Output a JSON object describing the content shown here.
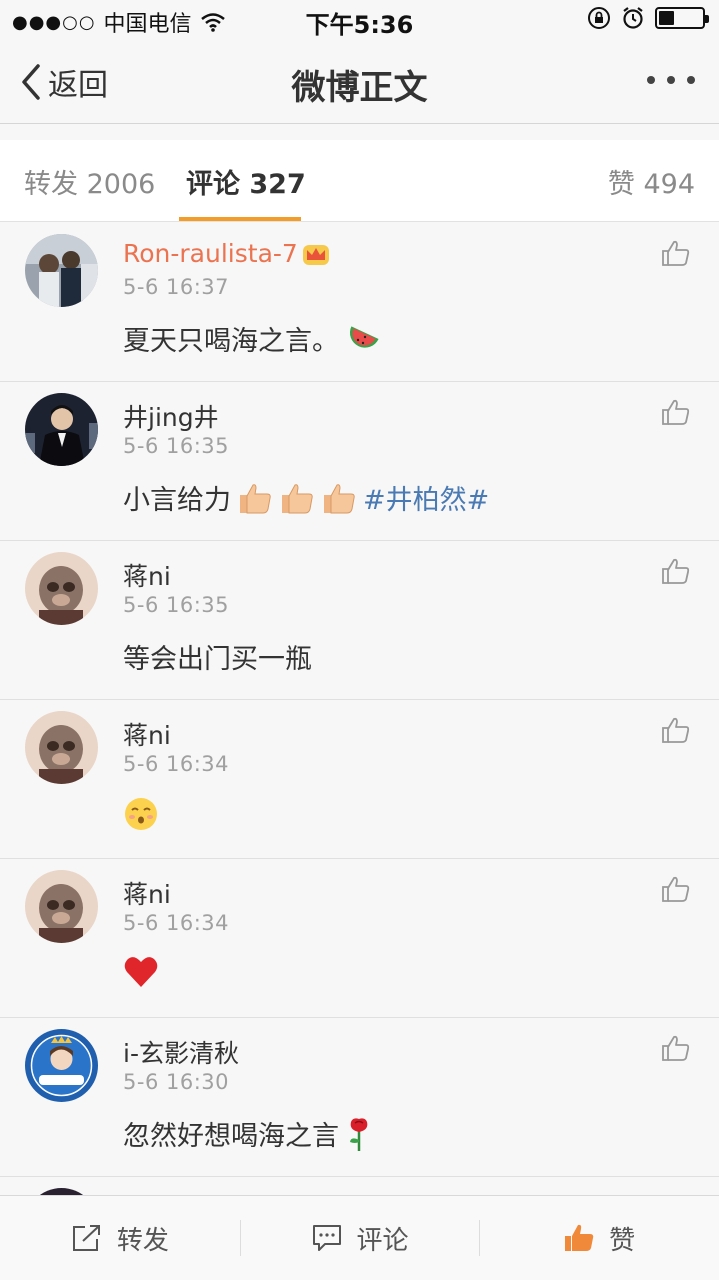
{
  "status_bar": {
    "carrier": "中国电信",
    "time": "下午5:36",
    "battery_level": 0.35
  },
  "nav": {
    "back_label": "返回",
    "title": "微博正文"
  },
  "tabs": {
    "repost": "转发 2006",
    "comment": "评论 327",
    "like": "赞 494"
  },
  "comments": [
    {
      "username": "Ron-raulista-7",
      "vip": true,
      "time": "5-6 16:37",
      "text": "夏天只喝海之言。",
      "emoji": "watermelon-emoji"
    },
    {
      "username": "井jing井",
      "vip": false,
      "time": "5-6 16:35",
      "text": "小言给力",
      "emoji": "thumbs-up-emoji",
      "emoji_count": 3,
      "topic": "#井柏然#"
    },
    {
      "username": "蒋ni",
      "vip": false,
      "time": "5-6 16:35",
      "text": "等会出门买一瓶"
    },
    {
      "username": "蒋ni",
      "vip": false,
      "time": "5-6 16:34",
      "text": "",
      "emoji": "kissing-face-emoji"
    },
    {
      "username": "蒋ni",
      "vip": false,
      "time": "5-6 16:34",
      "text": "",
      "emoji": "red-heart-emoji"
    },
    {
      "username": "i-玄影清秋",
      "vip": false,
      "time": "5-6 16:30",
      "text": "忽然好想喝海之言",
      "emoji": "rose-emoji"
    }
  ],
  "toolbar": {
    "repost": "转发",
    "comment": "评论",
    "like": "赞"
  },
  "colors": {
    "accent_orange": "#f29d2a",
    "vip_name": "#eb7350",
    "topic_blue": "#4a7ab3",
    "like_active": "#f08a3a"
  }
}
